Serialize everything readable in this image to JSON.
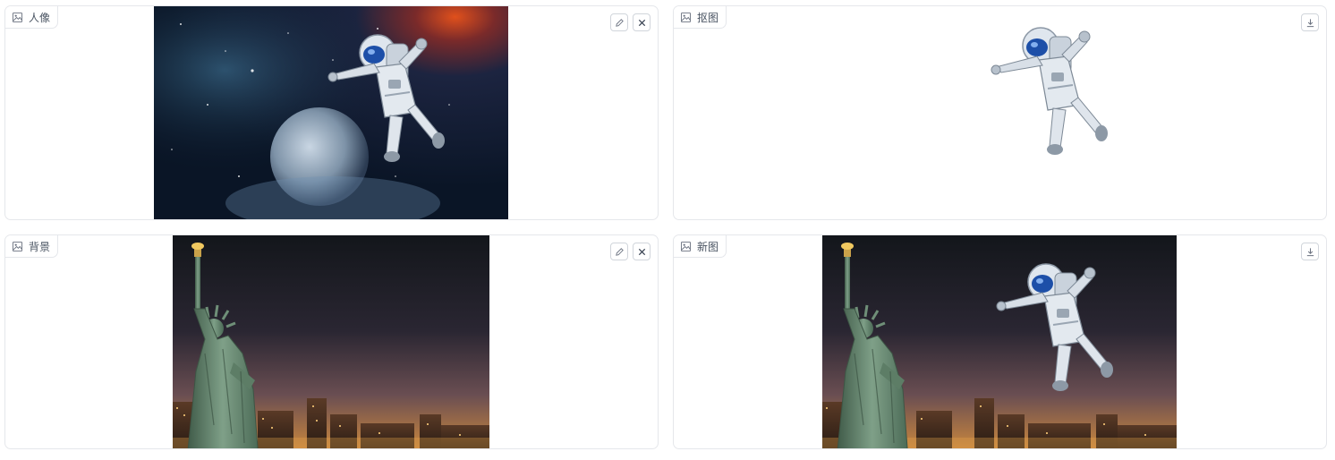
{
  "panels": {
    "portrait": {
      "label": "人像",
      "label_icon": "image-icon",
      "buttons": [
        "edit-icon",
        "close-icon"
      ]
    },
    "cutout": {
      "label": "抠图",
      "label_icon": "image-icon",
      "buttons": [
        "download-icon"
      ]
    },
    "background": {
      "label": "背景",
      "label_icon": "image-icon",
      "buttons": [
        "edit-icon",
        "close-icon"
      ]
    },
    "composite": {
      "label": "新图",
      "label_icon": "image-icon",
      "buttons": [
        "download-icon"
      ]
    }
  },
  "colors": {
    "border": "#e5e7eb",
    "space_dark": "#0b1a2e",
    "space_red": "#d3401a",
    "night_sky": "#14161c",
    "city_glow": "#d08a3a",
    "statue": "#6f8f78"
  }
}
